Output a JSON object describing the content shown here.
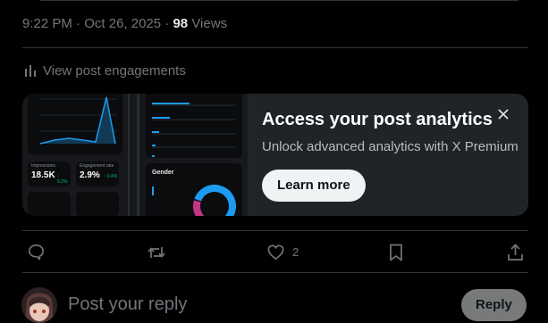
{
  "tweet_meta": {
    "time": "9:22 PM",
    "separator": " · ",
    "date": "Oct 26, 2025",
    "views_count": "98",
    "views_label": "Views"
  },
  "engagements": {
    "label": "View post engagements"
  },
  "premium_card": {
    "title": "Access your post analytics",
    "subtitle": "Unlock analytics with X Premium",
    "subtitle_full": "Unlock advanced analytics with X Premium",
    "cta": "Learn more",
    "preview": {
      "stat1_label": "Impressions",
      "stat1_value": "18.5K",
      "stat1_delta": "↑ 5.2%",
      "stat2_label": "Engagement rate",
      "stat2_value": "2.9%",
      "stat2_delta": "↑ 0.4%",
      "gender_title": "Gender"
    }
  },
  "actions": {
    "likes_count": "2"
  },
  "reply": {
    "placeholder": "Post your reply",
    "button": "Reply"
  },
  "colors": {
    "background": "#000000",
    "card": "#202327",
    "accent": "#1d9bf0",
    "muted": "#71767b",
    "divider": "#2f3336"
  }
}
